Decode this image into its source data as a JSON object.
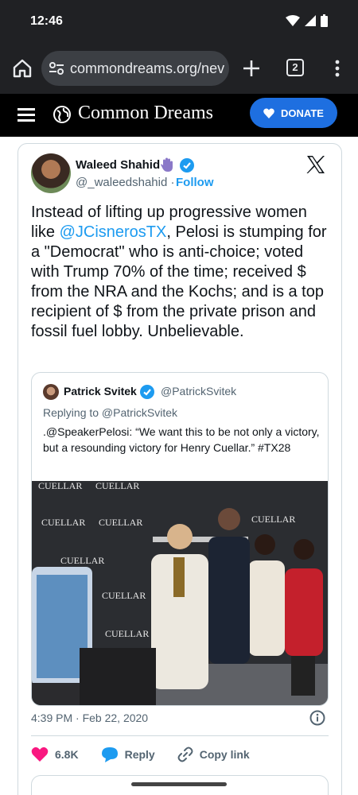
{
  "status": {
    "time": "12:46"
  },
  "browser": {
    "url": "commondreams.org/nev",
    "tab_count": "2"
  },
  "site": {
    "name": "Common Dreams",
    "donate_label": "DONATE"
  },
  "tweet": {
    "author_name": "Waleed Shahid",
    "author_handle": "@_waleedshahid",
    "separator": "·",
    "follow_label": "Follow",
    "text_before": "Instead of lifting up progressive women like ",
    "mention": "@JCisnerosTX",
    "text_after": ", Pelosi is stumping for a \"Democrat\" who is anti-choice; voted with Trump 70% of the time; received $ from the NRA and the Kochs; and is a top recipient of $ from the private prison and fossil fuel lobby. Unbelievable.",
    "timestamp": "4:39 PM · Feb 22, 2020",
    "like_count": "6.8K",
    "reply_label": "Reply",
    "copy_link_label": "Copy link"
  },
  "quote": {
    "author_name": "Patrick Svitek",
    "author_handle": "@PatrickSvitek",
    "replying_to": "Replying to @PatrickSvitek",
    "text": ".@SpeakerPelosi: “We want this to be not only a victory, but a resounding victory for Henry Cuellar.” #TX28",
    "backdrop_word": "CUELLAR"
  },
  "colors": {
    "accent": "#1d9bf0",
    "donate": "#1e6fe0",
    "like": "#f91880",
    "chrome_bg": "#202124"
  }
}
